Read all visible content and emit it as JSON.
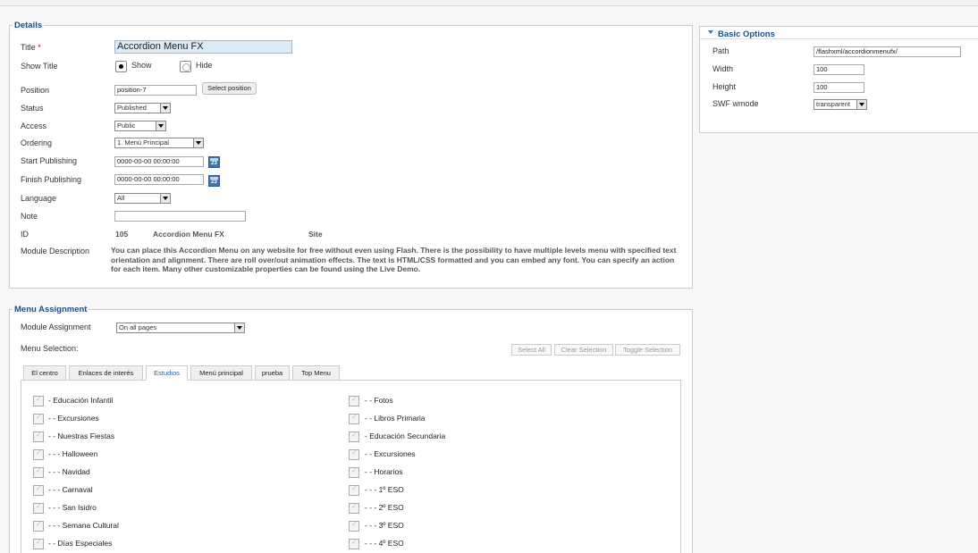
{
  "details": {
    "legend": "Details",
    "title": {
      "label": "Title",
      "required": "*",
      "value": "Accordion Menu FX"
    },
    "show_title": {
      "label": "Show Title",
      "show": "Show",
      "hide": "Hide",
      "selected": "Show"
    },
    "position": {
      "label": "Position",
      "value": "position-7",
      "button": "Select position"
    },
    "status": {
      "label": "Status",
      "value": "Published"
    },
    "access": {
      "label": "Access",
      "value": "Public"
    },
    "ordering": {
      "label": "Ordering",
      "value": "1. Menú Principal"
    },
    "start_publishing": {
      "label": "Start Publishing",
      "value": "0000-00-00 00:00:00"
    },
    "finish_publishing": {
      "label": "Finish Publishing",
      "value": "0000-00-00 00:00:00"
    },
    "language": {
      "label": "Language",
      "value": "All"
    },
    "note": {
      "label": "Note",
      "value": ""
    },
    "id": {
      "label": "ID",
      "number": "105",
      "name": "Accordion Menu FX",
      "client": "Site"
    },
    "module_description": {
      "label": "Module Description",
      "text": "You can place this Accordion Menu on any website for free without even using Flash. There is the possibility to have multiple levels menu with specified text orientation and alignment. There are roll over/out animation effects. The text is HTML/CSS formatted and you can embed any font. You can specify an action for each item. Many other customizable properties can be found using the Live Demo."
    },
    "calendar_icon_text": "23"
  },
  "basic_options": {
    "title": "Basic Options",
    "path": {
      "label": "Path",
      "value": "/flashxml/accordionmenufx/"
    },
    "width": {
      "label": "Width",
      "value": "100"
    },
    "height": {
      "label": "Height",
      "value": "100"
    },
    "swf_wmode": {
      "label": "SWF wmode",
      "value": "transparent"
    }
  },
  "menu_assignment": {
    "legend": "Menu Assignment",
    "module_assignment": {
      "label": "Module Assignment",
      "value": "On all pages"
    },
    "menu_selection_label": "Menu Selection:",
    "buttons": {
      "select_all": "Select All",
      "clear_selection": "Clear Selection",
      "toggle_selection": "Toggle Selection"
    },
    "tabs": [
      "El centro",
      "Enlaces de interés",
      "Estudios",
      "Menú principal",
      "prueba",
      "Top Menu"
    ],
    "active_tab": "Estudios",
    "left_items": [
      "- Educación Infantil",
      "- - Excursiones",
      "- - Nuestras Fiestas",
      "- - - Halloween",
      "- - - Navidad",
      "- - - Carnaval",
      "- - - San Isidro",
      "- - - Semana Cultural",
      "- - Días Especiales"
    ],
    "right_items": [
      "- - Fotos",
      "- - Libros Primaria",
      "- Educación Secundaria",
      "- - Excursiones",
      "- - Horarios",
      "- - - 1º ESO",
      "- - - 2º ESO",
      "- - - 3º ESO",
      "- - - 4º ESO"
    ]
  }
}
